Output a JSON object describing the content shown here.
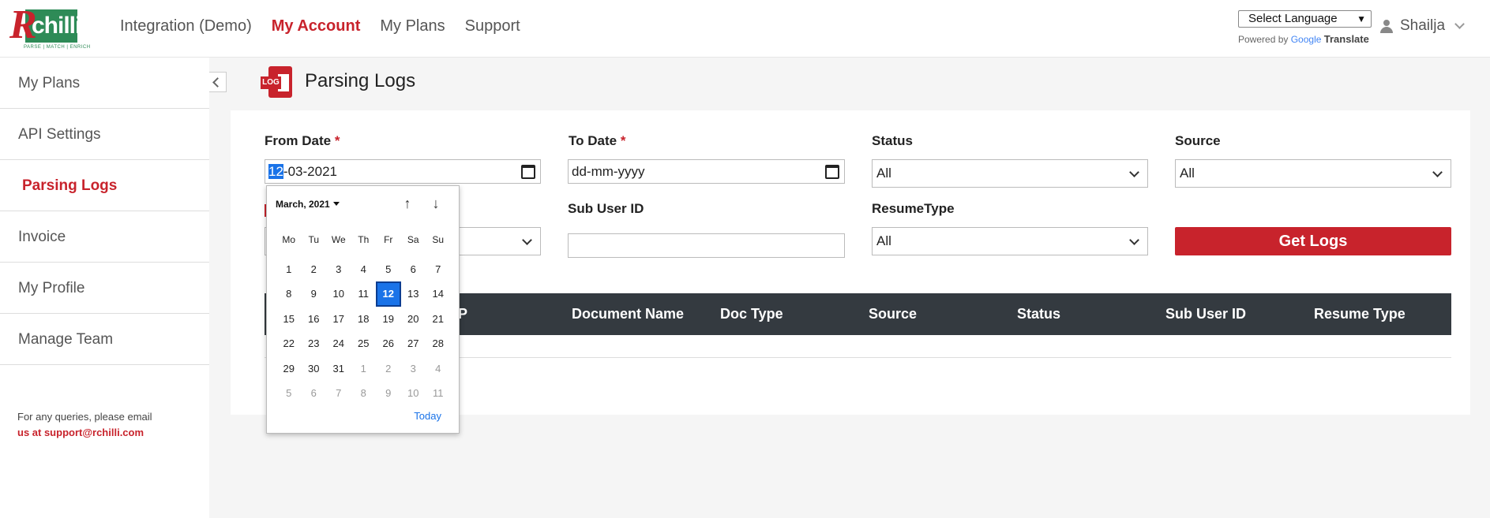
{
  "header": {
    "logo": {
      "mark": "R",
      "name": "chilli",
      "tagline": "PARSE | MATCH | ENRICH"
    },
    "nav": [
      "Integration (Demo)",
      "My Account",
      "My Plans",
      "Support"
    ],
    "active_nav": "My Account",
    "language_select": "Select Language",
    "powered_by": "Powered by",
    "google": "Google",
    "translate": "Translate",
    "user_name": "Shailja"
  },
  "sidebar": {
    "items": [
      "My Plans",
      "API Settings",
      "Parsing Logs",
      "Invoice",
      "My Profile",
      "Manage Team"
    ],
    "active": "Parsing Logs",
    "footer_line1": "For any queries, please email",
    "footer_line2": "us at support@rchilli.com"
  },
  "page": {
    "title": "Parsing Logs",
    "icon_label": "LOG"
  },
  "filters": {
    "from_date_label": "From Date",
    "from_date_day": "12",
    "from_date_rest": "-03-2021",
    "to_date_label": "To Date",
    "to_date_value": "dd-mm-yyyy",
    "required_mark": "*",
    "status_label": "Status",
    "status_value": "All",
    "source_label": "Source",
    "source_value": "All",
    "sub_user_id_label": "Sub User ID",
    "sub_user_id_value": "",
    "resume_type_label": "ResumeType",
    "resume_type_value": "All",
    "get_logs": "Get Logs"
  },
  "table": {
    "headers": [
      "IP",
      "Document Name",
      "Doc Type",
      "Source",
      "Status",
      "Sub User ID",
      "Resume Type"
    ]
  },
  "calendar": {
    "month_label": "March, 2021",
    "weekdays": [
      "Mo",
      "Tu",
      "We",
      "Th",
      "Fr",
      "Sa",
      "Su"
    ],
    "weeks": [
      [
        "1",
        "2",
        "3",
        "4",
        "5",
        "6",
        "7"
      ],
      [
        "8",
        "9",
        "10",
        "11",
        "12",
        "13",
        "14"
      ],
      [
        "15",
        "16",
        "17",
        "18",
        "19",
        "20",
        "21"
      ],
      [
        "22",
        "23",
        "24",
        "25",
        "26",
        "27",
        "28"
      ],
      [
        "29",
        "30",
        "31",
        "1",
        "2",
        "3",
        "4"
      ],
      [
        "5",
        "6",
        "7",
        "8",
        "9",
        "10",
        "11"
      ]
    ],
    "selected_day": "12",
    "today_label": "Today"
  },
  "colors": {
    "brand_red": "#c8232c",
    "accent_blue": "#1a73e8",
    "table_header": "#343a40"
  }
}
